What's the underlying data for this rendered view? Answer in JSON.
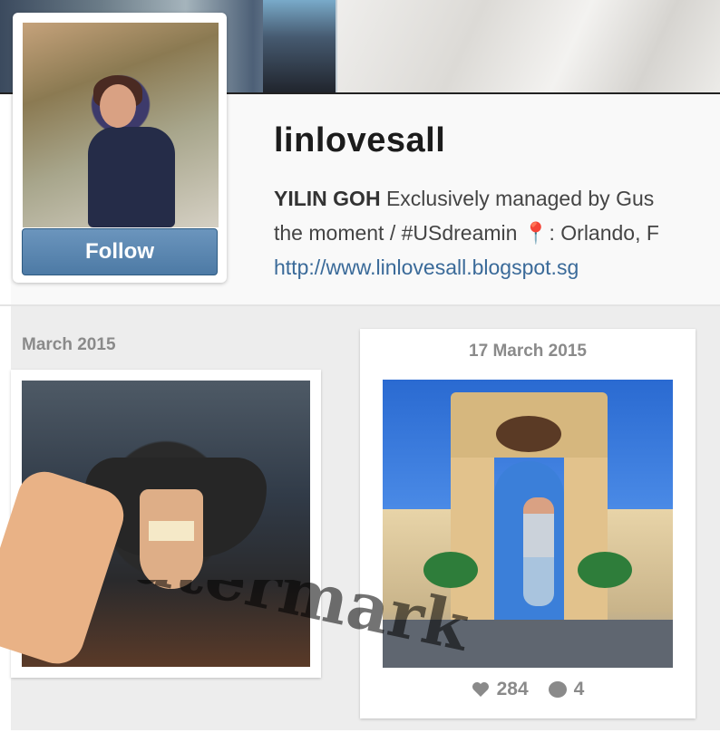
{
  "profile": {
    "username": "linlovesall",
    "follow_label": "Follow",
    "bio_name": "YILIN GOH",
    "bio_line1_rest": " Exclusively managed by Gus",
    "bio_line2_start": "the moment / #USdreamin ",
    "bio_pin": "📍",
    "bio_line2_end": ": Orlando, F",
    "website": "http://www.linlovesall.blogspot.sg"
  },
  "feed": {
    "month_label": "March 2015",
    "posts": [
      {
        "date": "",
        "likes": "",
        "comments": ""
      },
      {
        "date": "17 March 2015",
        "likes": "284",
        "comments": "4"
      }
    ]
  },
  "colors": {
    "follow_button": "#4d7aa5",
    "link": "#3a6a99",
    "feed_background": "#ededed"
  },
  "icons": [
    "heart-icon",
    "comment-icon",
    "location-pin-icon"
  ],
  "watermark": "watermark"
}
